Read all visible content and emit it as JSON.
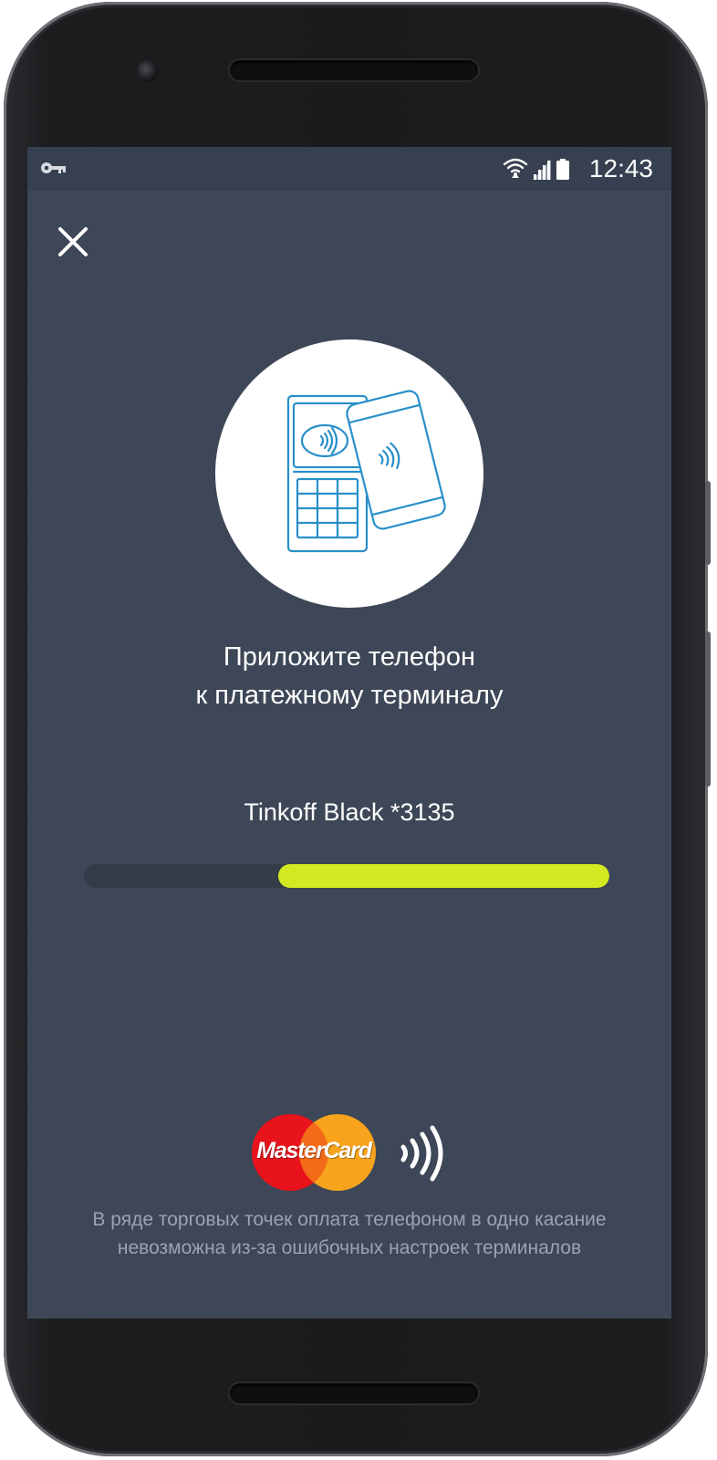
{
  "status_bar": {
    "time": "12:43",
    "icons": [
      "key-icon",
      "wifi-icon",
      "signal-icon",
      "battery-icon"
    ]
  },
  "payment_screen": {
    "close_icon": "close-icon",
    "illustration_icon": "nfc-terminal-icon",
    "instruction_line1": "Приложите телефон",
    "instruction_line2": "к платежному терминалу",
    "card_name": "Tinkoff Black *3135",
    "progress_fraction": 0.63,
    "brand_logo_text": "MasterCard",
    "contactless_icon": "contactless-icon",
    "disclaimer_line1": "В ряде торговых точек оплата телефоном в одно касание",
    "disclaimer_line2": "невозможна из-за ошибочных настроек терминалов"
  },
  "colors": {
    "screen_background": "#3e4757",
    "status_bar_background": "#364050",
    "progress_fill": "#d4e921",
    "progress_track": "#343c4a",
    "illustration_stroke": "#2a8fc9",
    "mastercard_red": "#e8131b",
    "mastercard_orange": "#f7a31c"
  }
}
